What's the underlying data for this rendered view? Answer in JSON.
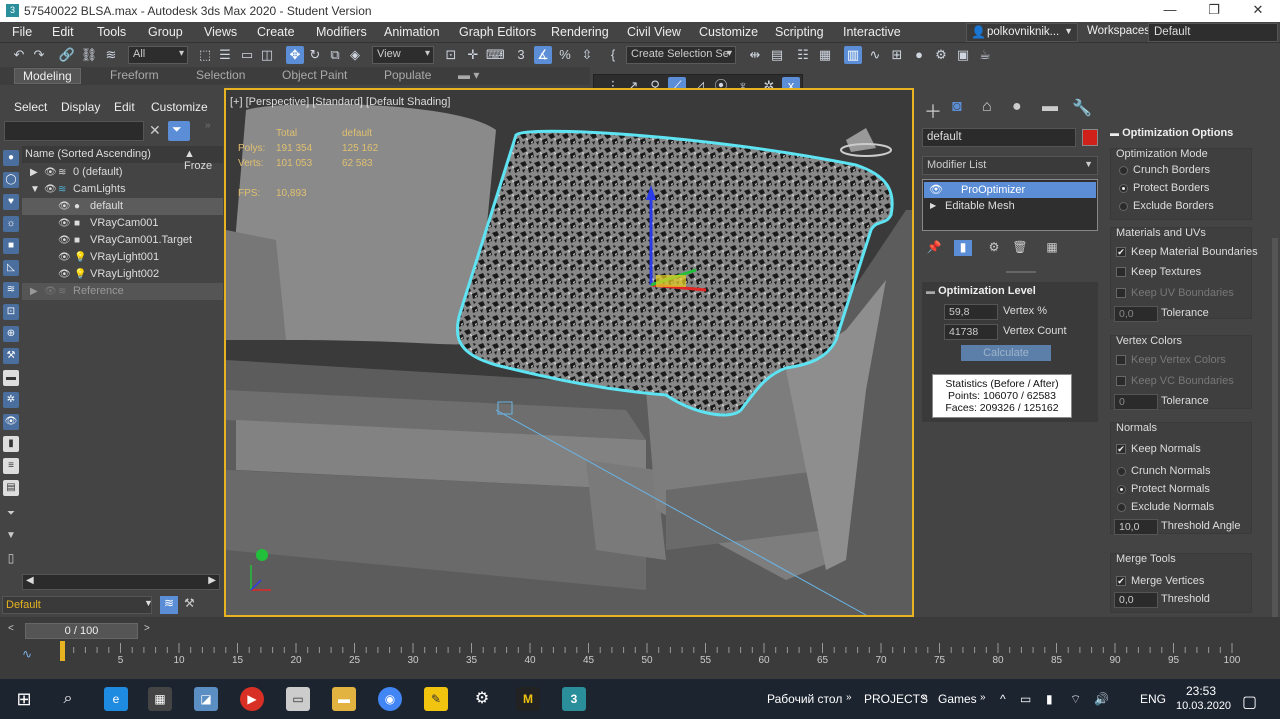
{
  "window": {
    "title": "57540022 BLSA.max - Autodesk 3ds Max 2020 - Student Version",
    "app_icon": "3ds-max-icon"
  },
  "menu": [
    "File",
    "Edit",
    "Tools",
    "Group",
    "Views",
    "Create",
    "Modifiers",
    "Animation",
    "Graph Editors",
    "Rendering",
    "Civil View",
    "Customize",
    "Scripting",
    "Interactive"
  ],
  "user": {
    "name": "polkovniknik..."
  },
  "workspaces": {
    "label": "Workspaces:",
    "value": "Default"
  },
  "toolbar": {
    "selection_filter": "All",
    "ref_coord": "View",
    "named_selection": "Create Selection Se"
  },
  "ribbon_tabs": [
    "Modeling",
    "Freeform",
    "Selection",
    "Object Paint",
    "Populate"
  ],
  "axis_constraints": [
    "X",
    "Y",
    "Z",
    "XY"
  ],
  "scene_explorer": {
    "tabs": [
      "Select",
      "Display",
      "Edit",
      "Customize"
    ],
    "column_header": "Name (Sorted Ascending)",
    "frozen_header": "▲ Froze",
    "rows": [
      {
        "label": "0 (default)",
        "level": 0
      },
      {
        "label": "CamLights",
        "level": 0
      },
      {
        "label": "default",
        "level": 1,
        "selected": true
      },
      {
        "label": "VRayCam001",
        "level": 1
      },
      {
        "label": "VRayCam001.Target",
        "level": 1
      },
      {
        "label": "VRayLight001",
        "level": 1
      },
      {
        "label": "VRayLight002",
        "level": 1
      },
      {
        "label": "Reference",
        "level": 0
      }
    ],
    "layer": "Default"
  },
  "viewport": {
    "label": "[+] [Perspective] [Standard] [Default Shading]",
    "stats": {
      "headers": [
        "Total",
        "default"
      ],
      "polys_label": "Polys:",
      "polys_total": "191 354",
      "polys_default": "125 162",
      "verts_label": "Verts:",
      "verts_total": "101 053",
      "verts_default": "62 583",
      "fps_label": "FPS:",
      "fps": "10,893"
    }
  },
  "command_panel": {
    "object_name": "default",
    "object_color": "#d0201a",
    "modifier_list": "Modifier List",
    "stack": [
      "ProOptimizer",
      "Editable Mesh"
    ],
    "optimization_level": {
      "title": "Optimization Level",
      "vertex_percent_value": "59,8",
      "vertex_percent_label": "Vertex %",
      "vertex_count_value": "41738",
      "vertex_count_label": "Vertex Count",
      "calculate": "Calculate",
      "stats_title": "Statistics (Before / After)",
      "stats_points": "Points: 106070 / 62583",
      "stats_faces": "Faces: 209326 / 125162"
    },
    "optimization_options": {
      "title": "Optimization Options",
      "mode_title": "Optimization Mode",
      "crunch_borders": "Crunch Borders",
      "protect_borders": "Protect Borders",
      "exclude_borders": "Exclude Borders",
      "materials_title": "Materials and UVs",
      "keep_material_boundaries": "Keep Material Boundaries",
      "keep_textures": "Keep Textures",
      "keep_uv_boundaries": "Keep UV Boundaries",
      "uv_tolerance_value": "0,0",
      "tolerance": "Tolerance",
      "vertex_colors_title": "Vertex Colors",
      "keep_vertex_colors": "Keep Vertex Colors",
      "keep_vc_boundaries": "Keep VC Boundaries",
      "vc_tolerance_value": "0",
      "normals_title": "Normals",
      "keep_normals": "Keep Normals",
      "crunch_normals": "Crunch Normals",
      "protect_normals": "Protect Normals",
      "exclude_normals": "Exclude Normals",
      "threshold_angle_value": "10,0",
      "threshold_angle": "Threshold Angle",
      "merge_title": "Merge Tools",
      "merge_vertices": "Merge Vertices",
      "merge_threshold_value": "0,0",
      "threshold": "Threshold"
    }
  },
  "timeline": {
    "frame_display": "0 / 100",
    "ticks": [
      "5",
      "10",
      "15",
      "20",
      "25",
      "30",
      "35",
      "40",
      "45",
      "50",
      "55",
      "60",
      "65",
      "70",
      "75",
      "80",
      "85",
      "90",
      "95",
      "100"
    ]
  },
  "taskbar": {
    "desktop": "Рабочий стол",
    "projects": "PROJECTS",
    "games": "Games",
    "lang": "ENG",
    "time": "23:53",
    "date": "10.03.2020"
  }
}
